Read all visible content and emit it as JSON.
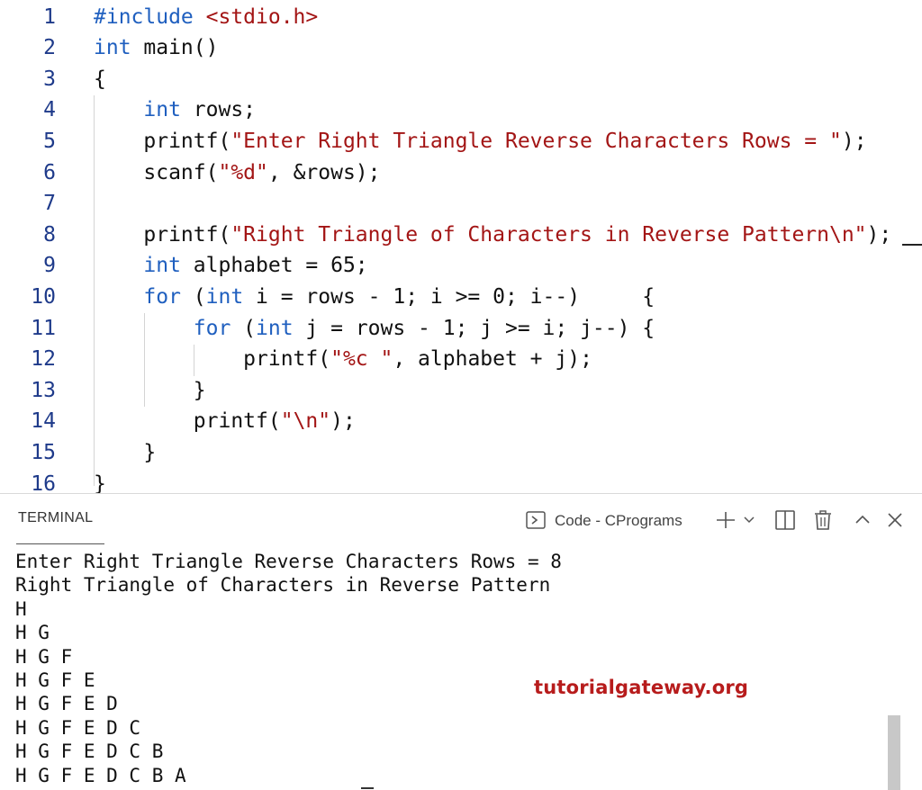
{
  "editor": {
    "lines": [
      {
        "num": "1",
        "tokens": [
          {
            "t": "#include ",
            "c": "kw"
          },
          {
            "t": "<stdio.h>",
            "c": "str"
          }
        ]
      },
      {
        "num": "2",
        "tokens": [
          {
            "t": "int",
            "c": "kw"
          },
          {
            "t": " main()",
            "c": ""
          }
        ]
      },
      {
        "num": "3",
        "tokens": [
          {
            "t": "{",
            "c": ""
          }
        ]
      },
      {
        "num": "4",
        "tokens": [
          {
            "t": "    ",
            "c": ""
          },
          {
            "t": "int",
            "c": "kw"
          },
          {
            "t": " rows;",
            "c": ""
          }
        ]
      },
      {
        "num": "5",
        "tokens": [
          {
            "t": "    printf(",
            "c": ""
          },
          {
            "t": "\"Enter Right Triangle Reverse Characters Rows = \"",
            "c": "str"
          },
          {
            "t": ");",
            "c": ""
          }
        ]
      },
      {
        "num": "6",
        "tokens": [
          {
            "t": "    scanf(",
            "c": ""
          },
          {
            "t": "\"%d\"",
            "c": "str"
          },
          {
            "t": ", &rows);",
            "c": ""
          }
        ]
      },
      {
        "num": "7",
        "tokens": []
      },
      {
        "num": "8",
        "tokens": [
          {
            "t": "    printf(",
            "c": ""
          },
          {
            "t": "\"Right Triangle of Characters in Reverse Pattern\\n\"",
            "c": "str"
          },
          {
            "t": ");",
            "c": ""
          }
        ]
      },
      {
        "num": "9",
        "tokens": [
          {
            "t": "    ",
            "c": ""
          },
          {
            "t": "int",
            "c": "kw"
          },
          {
            "t": " alphabet = 65;",
            "c": ""
          }
        ]
      },
      {
        "num": "10",
        "tokens": [
          {
            "t": "    ",
            "c": ""
          },
          {
            "t": "for",
            "c": "kw"
          },
          {
            "t": " (",
            "c": ""
          },
          {
            "t": "int",
            "c": "kw"
          },
          {
            "t": " i = rows - 1; i >= 0; i--)     {",
            "c": ""
          }
        ]
      },
      {
        "num": "11",
        "tokens": [
          {
            "t": "        ",
            "c": ""
          },
          {
            "t": "for",
            "c": "kw"
          },
          {
            "t": " (",
            "c": ""
          },
          {
            "t": "int",
            "c": "kw"
          },
          {
            "t": " j = rows - 1; j >= i; j--) {",
            "c": ""
          }
        ]
      },
      {
        "num": "12",
        "tokens": [
          {
            "t": "            printf(",
            "c": ""
          },
          {
            "t": "\"%c \"",
            "c": "str"
          },
          {
            "t": ", alphabet + j);",
            "c": ""
          }
        ]
      },
      {
        "num": "13",
        "tokens": [
          {
            "t": "        }",
            "c": ""
          }
        ]
      },
      {
        "num": "14",
        "tokens": [
          {
            "t": "        printf(",
            "c": ""
          },
          {
            "t": "\"\\n\"",
            "c": "str"
          },
          {
            "t": ");",
            "c": ""
          }
        ]
      },
      {
        "num": "15",
        "tokens": [
          {
            "t": "    }",
            "c": ""
          }
        ]
      },
      {
        "num": "16",
        "tokens": [
          {
            "t": "}",
            "c": ""
          }
        ]
      }
    ]
  },
  "terminal": {
    "tab_label": "TERMINAL",
    "shell_label": "Code - CPrograms",
    "icons": [
      "shell-icon",
      "plus-icon",
      "chevron-down-icon",
      "split-icon",
      "trash-icon",
      "chevron-up-icon",
      "close-icon"
    ],
    "output_lines": [
      "Enter Right Triangle Reverse Characters Rows = 8",
      "Right Triangle of Characters in Reverse Pattern",
      "H",
      "H G",
      "H G F",
      "H G F E",
      "H G F E D",
      "H G F E D C",
      "H G F E D C B",
      "H G F E D C B A"
    ],
    "watermark": "tutorialgateway.org"
  },
  "colors": {
    "keyword": "#1f5fbf",
    "string": "#a31515",
    "line_number": "#1e3a8a",
    "watermark": "#b71c1c"
  }
}
